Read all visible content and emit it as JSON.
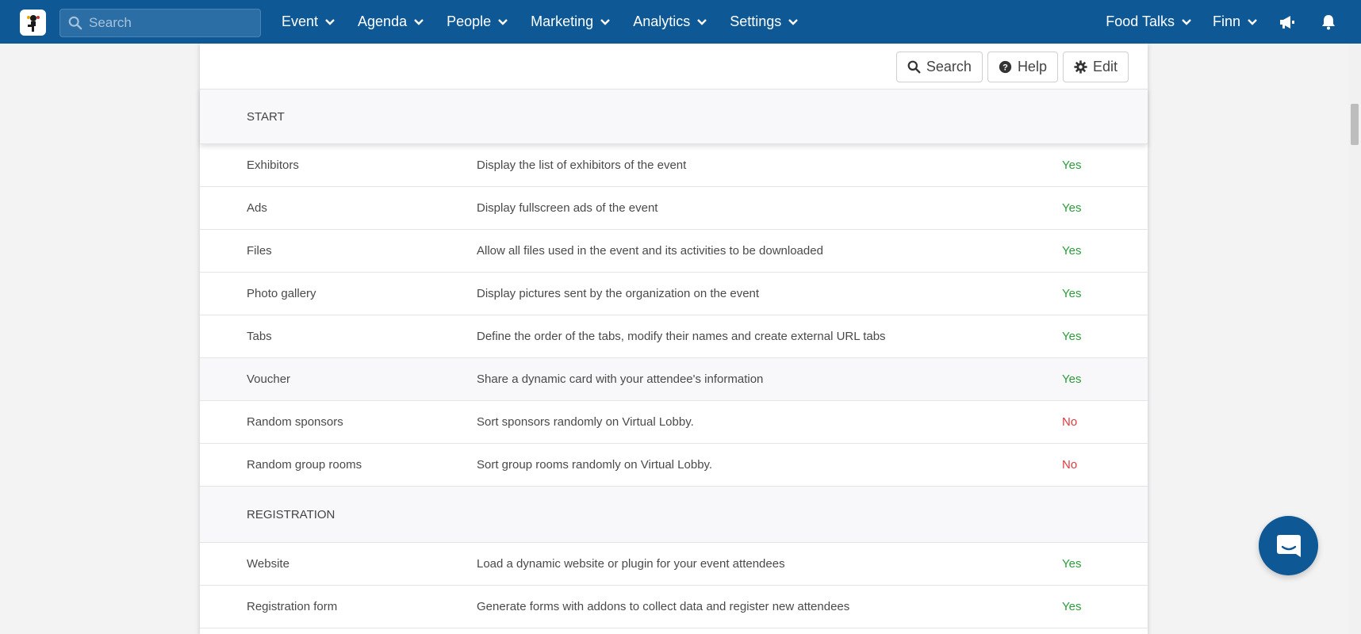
{
  "nav": {
    "search_placeholder": "Search",
    "menu": [
      "Event",
      "Agenda",
      "People",
      "Marketing",
      "Analytics",
      "Settings"
    ],
    "event_name": "Food Talks",
    "user_name": "Finn"
  },
  "toolbar": {
    "search_label": "Search",
    "help_label": "Help",
    "edit_label": "Edit"
  },
  "sections": [
    {
      "title": "START",
      "rows": [
        {
          "name": "Exhibitors",
          "description": "Display the list of exhibitors of the event",
          "value": "Yes"
        },
        {
          "name": "Ads",
          "description": "Display fullscreen ads of the event",
          "value": "Yes"
        },
        {
          "name": "Files",
          "description": "Allow all files used in the event and its activities to be downloaded",
          "value": "Yes"
        },
        {
          "name": "Photo gallery",
          "description": "Display pictures sent by the organization on the event",
          "value": "Yes"
        },
        {
          "name": "Tabs",
          "description": "Define the order of the tabs, modify their names and create external URL tabs",
          "value": "Yes"
        },
        {
          "name": "Voucher",
          "description": "Share a dynamic card with your attendee's information",
          "value": "Yes"
        },
        {
          "name": "Random sponsors",
          "description": "Sort sponsors randomly on Virtual Lobby.",
          "value": "No"
        },
        {
          "name": "Random group rooms",
          "description": "Sort group rooms randomly on Virtual Lobby.",
          "value": "No"
        }
      ]
    },
    {
      "title": "REGISTRATION",
      "rows": [
        {
          "name": "Website",
          "description": "Load a dynamic website or plugin for your event attendees",
          "value": "Yes"
        },
        {
          "name": "Registration form",
          "description": "Generate forms with addons to collect data and register new attendees",
          "value": "Yes"
        }
      ]
    }
  ],
  "colors": {
    "nav_bg": "#0e5896",
    "yes": "#2a9d3a",
    "no": "#e0393e"
  }
}
